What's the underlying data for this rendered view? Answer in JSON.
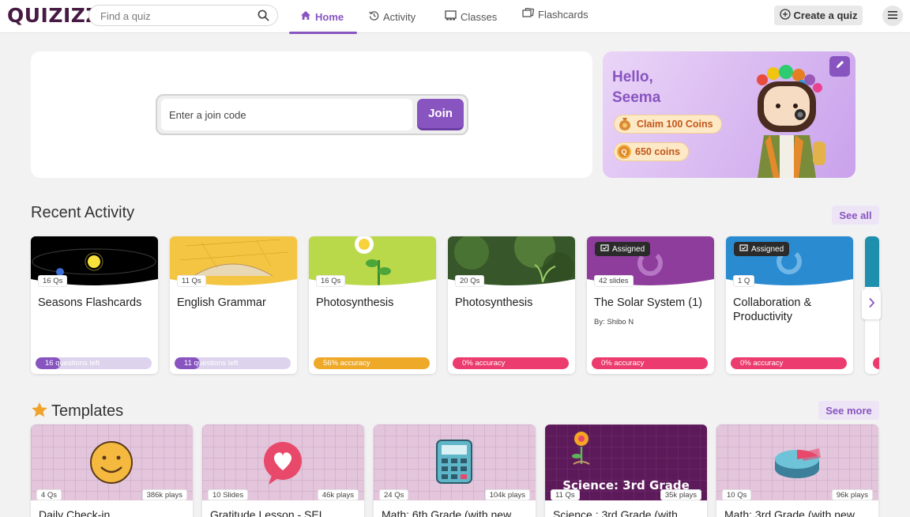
{
  "header": {
    "logo_text": "QUIZIZZ",
    "search_placeholder": "Find a quiz",
    "nav": [
      {
        "label": "Home",
        "icon": "home-icon",
        "active": true
      },
      {
        "label": "Activity",
        "icon": "history-icon",
        "active": false
      },
      {
        "label": "Classes",
        "icon": "classroom-icon",
        "active": false
      },
      {
        "label": "Flashcards",
        "icon": "flashcards-icon",
        "active": false
      }
    ],
    "create_label": "Create a quiz"
  },
  "join": {
    "placeholder": "Enter a join code",
    "button_label": "Join"
  },
  "greeting": {
    "line1": "Hello,",
    "line2": "Seema",
    "claim_label": "Claim 100 Coins",
    "coins_label": "650 coins"
  },
  "recent": {
    "title": "Recent Activity",
    "see_all": "See all",
    "cards": [
      {
        "title": "Seasons Flashcards",
        "count": "16 Qs",
        "status": "16 questions left",
        "progress": 0.15,
        "kind": "questions",
        "assigned": false,
        "author": ""
      },
      {
        "title": "English Grammar",
        "count": "11 Qs",
        "status": "11 questions left",
        "progress": 0.15,
        "kind": "questions",
        "assigned": false,
        "author": ""
      },
      {
        "title": "Photosynthesis",
        "count": "16 Qs",
        "status": "56% accuracy",
        "progress": 1.0,
        "kind": "accuracy-mid",
        "assigned": false,
        "author": ""
      },
      {
        "title": "Photosynthesis",
        "count": "20 Qs",
        "status": "0% accuracy",
        "progress": 1.0,
        "kind": "accuracy-low",
        "assigned": false,
        "author": ""
      },
      {
        "title": "The Solar System (1)",
        "count": "42 slides",
        "status": "0% accuracy",
        "progress": 1.0,
        "kind": "accuracy-low",
        "assigned": true,
        "author": "By: Shibo N"
      },
      {
        "title": "Collaboration & Productivity",
        "count": "1 Q",
        "status": "0% accuracy",
        "progress": 1.0,
        "kind": "accuracy-low",
        "assigned": true,
        "author": ""
      }
    ],
    "assigned_label": "Assigned"
  },
  "templates": {
    "title": "Templates",
    "see_more": "See more",
    "cards": [
      {
        "title": "Daily Check-in",
        "count": "4 Qs",
        "plays": "386k plays"
      },
      {
        "title": "Gratitude Lesson - SEL",
        "count": "10 Slides",
        "plays": "46k plays"
      },
      {
        "title": "Math: 6th Grade (with new",
        "count": "24 Qs",
        "plays": "104k plays"
      },
      {
        "title": "Science : 3rd Grade (with",
        "count": "11 Qs",
        "plays": "35k plays",
        "banner": "Science: 3rd Grade"
      },
      {
        "title": "Math: 3rd Grade (with new",
        "count": "10 Qs",
        "plays": "96k plays"
      }
    ]
  },
  "colors": {
    "brand": "#8854c0",
    "questions_bar": "#8854c0",
    "accuracy_mid": "#efa929",
    "accuracy_low": "#ec3b6e"
  }
}
